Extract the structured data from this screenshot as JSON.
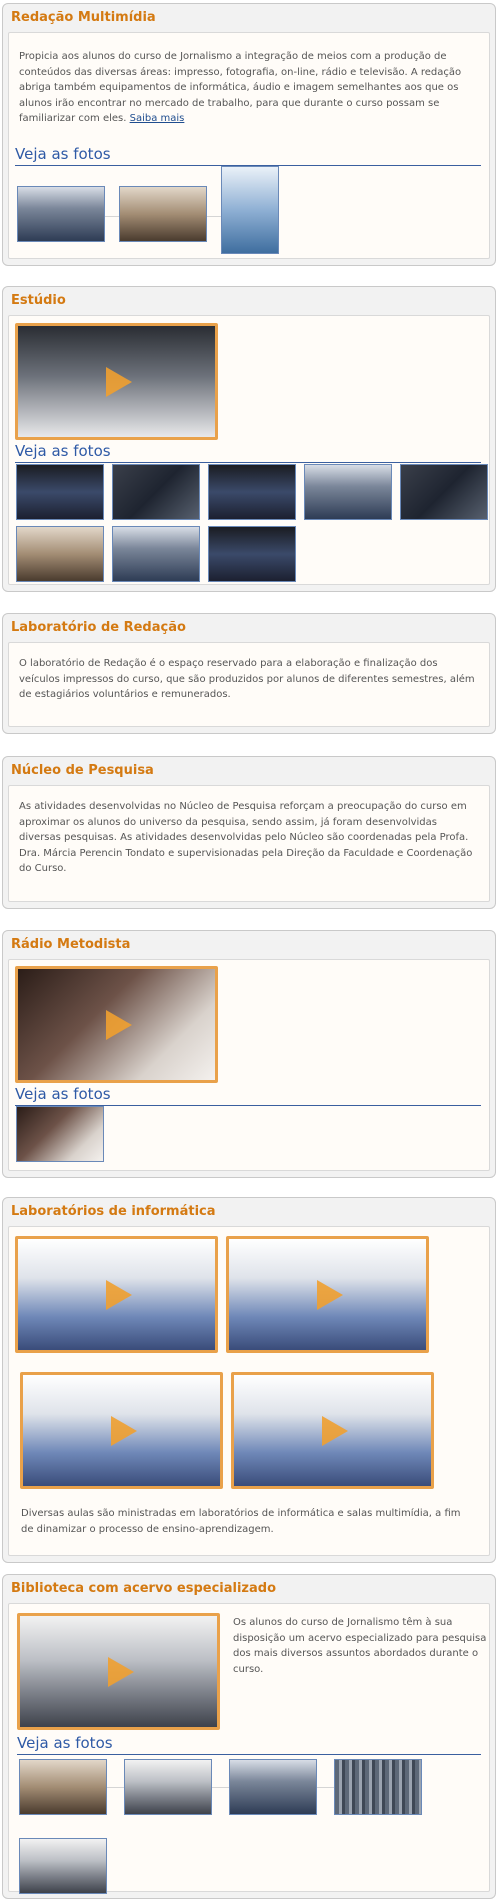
{
  "sections": {
    "redacao": {
      "title": "Redação Multimídia",
      "text": "Propicia aos alunos do curso de Jornalismo a integração de meios com a produção de conteúdos das diversas áreas: impresso, fotografia, on-line, rádio e televisão. A redação abriga também equipamentos de informática, áudio e imagem semelhantes aos que os alunos irão encontrar no mercado de trabalho, para que durante o curso possam se familiarizar com eles.",
      "link": "Saiba mais",
      "photos_label": "Veja as fotos"
    },
    "estudio": {
      "title": "Estúdio",
      "photos_label": "Veja as fotos"
    },
    "lab_redacao": {
      "title": "Laboratório de Redação",
      "text": "O laboratório de Redação é o espaço reservado para a elaboração e finalização dos veículos impressos do curso, que são produzidos por alunos de diferentes semestres, além de estagiários voluntários e remunerados."
    },
    "nucleo": {
      "title": "Núcleo de Pesquisa",
      "text": "As atividades desenvolvidas no Núcleo de Pesquisa reforçam a preocupação do curso em aproximar os alunos do universo da pesquisa, sendo assim, já foram desenvolvidas diversas pesquisas. As atividades desenvolvidas pelo Núcleo são coordenadas pela Profa. Dra. Márcia Perencin Tondato e supervisionadas pela Direção da Faculdade e Coordenação do Curso."
    },
    "radio": {
      "title": "Rádio Metodista",
      "photos_label": "Veja as fotos"
    },
    "lab_info": {
      "title": "Laboratórios de informática",
      "text": "Diversas aulas são ministradas em laboratórios de informática e salas multimídia, a fim de dinamizar o processo de ensino-aprendizagem."
    },
    "biblioteca": {
      "title": "Biblioteca com acervo especializado",
      "text": "Os alunos do curso de Jornalismo têm à sua disposição um acervo especializado para pesquisa dos mais diversos assuntos abordados durante o curso.",
      "photos_label": "Veja as fotos"
    }
  },
  "icons": {
    "video": "play-icon"
  },
  "colors": {
    "heading": "#d47a12",
    "link": "#2f5aa6",
    "video_border": "#e9a14a"
  }
}
